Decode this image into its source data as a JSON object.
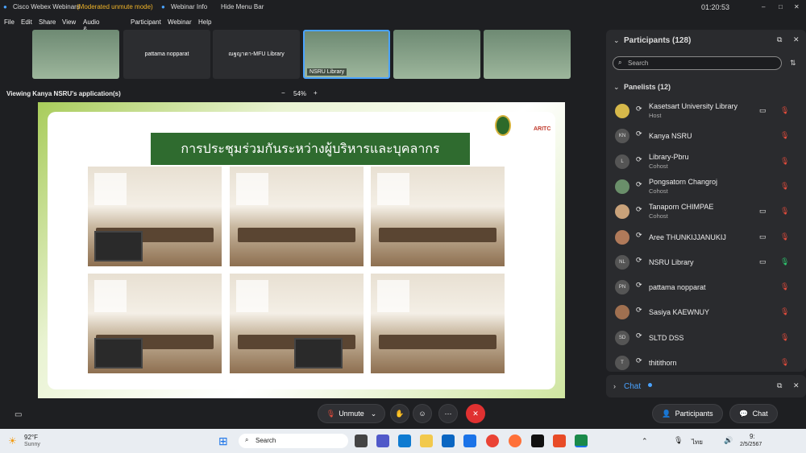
{
  "titlebar": {
    "app": "Cisco Webex Webinars",
    "mode": "(Moderated unmute mode)",
    "webinar_info": "Webinar Info",
    "hide_menu": "Hide Menu Bar",
    "time": "01:20:53"
  },
  "menu": [
    "File",
    "Edit",
    "Share",
    "View",
    "Audio & Video",
    "Participant",
    "Webinar",
    "Help"
  ],
  "thumbs": {
    "t2": "pattama nopparat",
    "t3": "ณฐญาดา-MFU Library",
    "t4": "NSRU Library"
  },
  "view": {
    "label": "Viewing Kanya NSRU's application(s)",
    "zoom": "54%"
  },
  "slide": {
    "title": "การประชุมร่วมกันระหว่างผู้บริหารและบุคลากร",
    "logo_text": "ARITC"
  },
  "panel": {
    "title": "Participants (128)",
    "search_placeholder": "Search",
    "panelists": "Panelists (12)",
    "people": [
      {
        "name": "Kasetsart University Library",
        "role": "Host",
        "init": ""
      },
      {
        "name": "Kanya NSRU",
        "role": "",
        "init": "KN"
      },
      {
        "name": "Library-Pbru",
        "role": "Cohost",
        "init": "L"
      },
      {
        "name": "Pongsatorn Changroj",
        "role": "Cohost",
        "init": ""
      },
      {
        "name": "Tanaporn CHIMPAE",
        "role": "Cohost",
        "init": ""
      },
      {
        "name": "Aree THUNKIJJANUKIJ",
        "role": "",
        "init": ""
      },
      {
        "name": "NSRU Library",
        "role": "",
        "init": "NL"
      },
      {
        "name": "pattama nopparat",
        "role": "",
        "init": "PN"
      },
      {
        "name": "Sasiya KAEWNUY",
        "role": "",
        "init": ""
      },
      {
        "name": "SLTD DSS",
        "role": "",
        "init": "SD"
      },
      {
        "name": "thitithorn",
        "role": "",
        "init": "T"
      }
    ]
  },
  "chat": {
    "label": "Chat"
  },
  "controls": {
    "unmute": "Unmute",
    "participants": "Participants",
    "chat": "Chat"
  },
  "taskbar": {
    "temp": "92°F",
    "weather": "Sunny",
    "search": "Search",
    "time": "9:",
    "date": "2/5/2567",
    "lang": "ไทย"
  }
}
